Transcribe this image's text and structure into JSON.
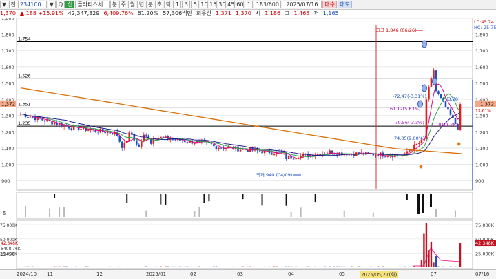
{
  "toolbar": {
    "items": [
      {
        "label": "▼",
        "kind": "sq"
      },
      {
        "label": "전",
        "kind": "sq"
      },
      {
        "label": "234100",
        "kind": "code"
      },
      {
        "label": "▼",
        "kind": "sq"
      },
      {
        "label": "Q",
        "kind": "sq"
      },
      {
        "label": "신",
        "kind": "green"
      },
      {
        "label": "폴라리스세",
        "kind": "name"
      },
      {
        "label": "분",
        "kind": "sq"
      },
      {
        "label": "주",
        "kind": "sq"
      },
      {
        "label": "월",
        "kind": "sq"
      },
      {
        "label": "년",
        "kind": "sq"
      },
      {
        "label": "분",
        "kind": "sq"
      },
      {
        "label": "초",
        "kind": "sq"
      },
      {
        "label": "틱",
        "kind": "sq"
      },
      {
        "label": "1",
        "kind": "sq"
      },
      {
        "label": "3",
        "kind": "sq"
      },
      {
        "label": "5",
        "kind": "sq"
      },
      {
        "label": "10",
        "kind": "sq"
      },
      {
        "label": "15",
        "kind": "sq"
      },
      {
        "label": "30",
        "kind": "sq"
      },
      {
        "label": "45",
        "kind": "sq"
      },
      {
        "label": "60",
        "kind": "sq"
      },
      {
        "label": "1",
        "kind": "sq"
      },
      {
        "label": "183/600",
        "kind": "cnt"
      },
      {
        "label": "2025/07/16",
        "kind": "date"
      },
      {
        "label": "매수",
        "kind": "buy"
      },
      {
        "label": "매도",
        "kind": "sell"
      }
    ]
  },
  "info": {
    "price": "1,370",
    "change": "▲ 188 +15.91%",
    "volume": "42,347,829",
    "turnover": "6,409.76%",
    "ratio": "61.20%",
    "amount": "57,306백만",
    "label_rotation": "회우선",
    "v1": "1,371",
    "v2": "1,370",
    "open_label": "시",
    "open": "1,186",
    "high_label": "고",
    "high": "1,465",
    "low_label": "저",
    "low": "1,165"
  },
  "price_axis": [
    "1,900",
    "1,800",
    "1,700",
    "1,600",
    "1,500",
    "1,400",
    "1,300",
    "1,200",
    "1,100",
    "1,000",
    "900"
  ],
  "price_axis_right": [
    "1,800",
    "1,700",
    "1,600",
    "1,500",
    "1,400",
    "1,300",
    "1,200",
    "1,100",
    "1,000",
    "900"
  ],
  "right_labels": {
    "lc": "LC:45.74",
    "hc": "HC:-25.75",
    "cur": "1,372",
    "cur2": "13.61%",
    "cur3": "1,372"
  },
  "left_current": "1,372",
  "hlines": [
    {
      "label": "1,754",
      "value": 1754
    },
    {
      "label": "1,526",
      "value": 1526
    },
    {
      "label": "1,351",
      "value": 1351
    },
    {
      "label": "1,235",
      "value": 1235
    }
  ],
  "annotations": {
    "high": "최고 1,846 (06/26)",
    "low": "최저 940 (04/09)",
    "a1": "-72.47(-3.31%)",
    "a2": "(3,78)",
    "a3": "61.12(5.63%)",
    "a4": "-70.56(-3.3%)",
    "a5": "74.05(9.00%)",
    "a6": "1,101(1.78)"
  },
  "volume_axis_left": [
    "75,000K",
    "50,000K",
    "25,000K"
  ],
  "volume_axis_right": [
    "75,000K",
    "50,000K",
    "25,000K"
  ],
  "volume_labels": {
    "v1": "42,348K",
    "v2": "6408.76K",
    "v3": "1345K"
  },
  "mid_axis": {
    "label": "5"
  },
  "date_axis": [
    "2024/10",
    "11",
    "12",
    "2025/01",
    "02",
    "03",
    "04",
    "05",
    "2025/05/27(화)",
    "07",
    "07/16"
  ],
  "colors": {
    "up": "#e0201c",
    "down": "#1b4fc4",
    "ma5": "#e6007e",
    "ma20": "#1f1f8f",
    "ma60": "#d9700a",
    "ma_green": "#2fa34a"
  }
}
